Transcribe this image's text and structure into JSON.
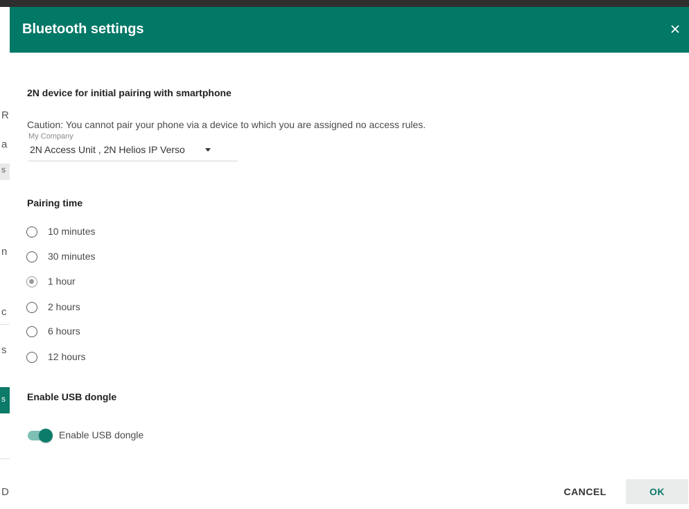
{
  "dialog": {
    "title": "Bluetooth settings",
    "close_icon": "close-icon"
  },
  "pairing_device": {
    "section_title": "2N device for initial pairing with smartphone",
    "caution": "Caution: You cannot pair your phone via a device to which you are assigned no access rules.",
    "select_label": "My Company",
    "select_value": "2N Access Unit , 2N Helios IP Verso"
  },
  "pairing_time": {
    "section_title": "Pairing time",
    "options": [
      {
        "label": "10 minutes",
        "checked": false
      },
      {
        "label": "30 minutes",
        "checked": false
      },
      {
        "label": "1 hour",
        "checked": true
      },
      {
        "label": "2 hours",
        "checked": false
      },
      {
        "label": "6 hours",
        "checked": false
      },
      {
        "label": "12 hours",
        "checked": false
      }
    ]
  },
  "usb_dongle": {
    "section_title": "Enable USB dongle",
    "toggle_label": "Enable USB dongle",
    "enabled": true
  },
  "actions": {
    "cancel_label": "CANCEL",
    "ok_label": "OK"
  },
  "colors": {
    "header": "#027867",
    "accent": "#0b7a68",
    "toggle_track": "#7ebfb4"
  },
  "background_fragments": [
    "R",
    "a",
    "s",
    "n",
    "c",
    "s",
    "s",
    "D"
  ]
}
